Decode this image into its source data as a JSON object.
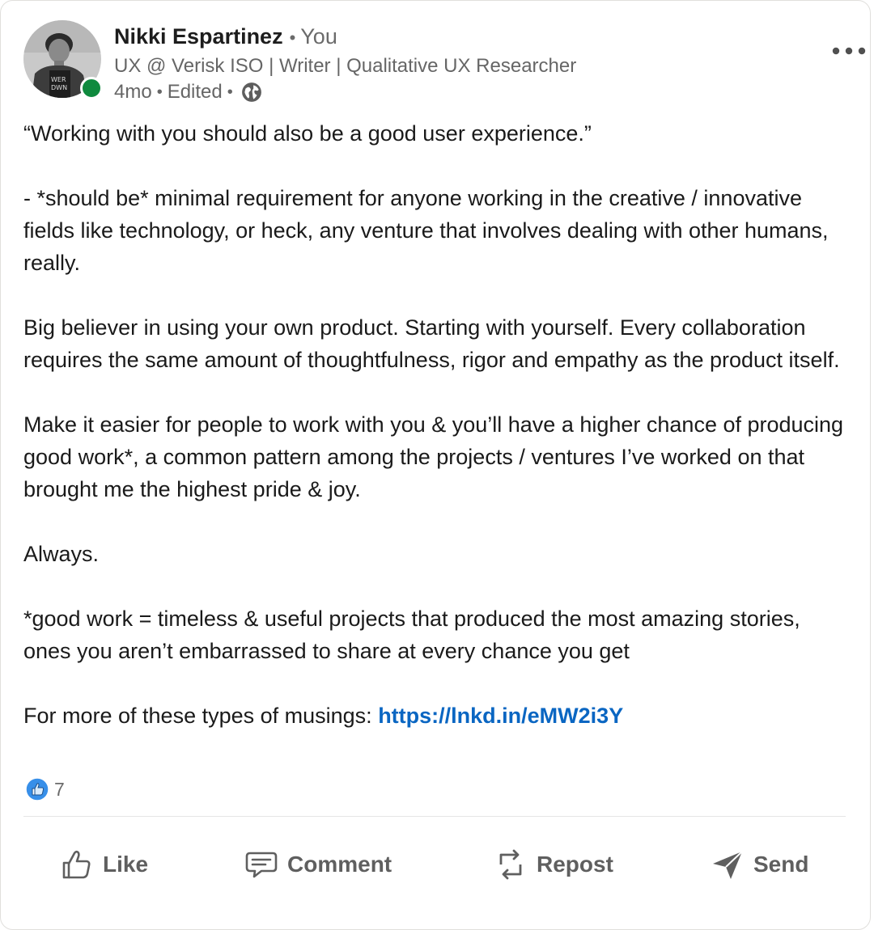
{
  "post": {
    "author": {
      "name": "Nikki Espartinez",
      "relation": "You",
      "headline": "UX @ Verisk ISO | Writer | Qualitative UX Researcher",
      "time": "4mo",
      "edited": "Edited",
      "visibility_icon": "globe-icon",
      "presence_color": "#0f8a3e",
      "avatar_shirt_text": "WER\nDWN"
    },
    "more_icon": "more-horizontal-icon",
    "paragraphs": [
      "“Working with you should also be a good user experience.”",
      "- *should be* minimal requirement for anyone working in the creative / innovative fields like technology, or heck, any venture that involves dealing with other humans, really.",
      "Big believer in using your own product. Starting with yourself. Every collaboration requires the same amount of thoughtfulness, rigor and empathy as the product itself.",
      "Make it easier for people to work with you & you’ll have a higher chance of producing good work*, a common pattern among the projects / ventures I’ve worked on that brought me the highest pride & joy.",
      "Always.",
      "*good work = timeless & useful projects that produced the most amazing stories, ones you aren’t embarrassed to share at every chance you get"
    ],
    "link_prefix": "For more of these types of musings: ",
    "link_text": "https://lnkd.in/eMW2i3Y",
    "link_color": "#0a66c2",
    "reactions": {
      "icon": "like-reaction-icon",
      "count": "7"
    },
    "actions": [
      {
        "label": "Like",
        "icon": "like-icon"
      },
      {
        "label": "Comment",
        "icon": "comment-icon"
      },
      {
        "label": "Repost",
        "icon": "repost-icon"
      },
      {
        "label": "Send",
        "icon": "send-icon"
      }
    ]
  }
}
